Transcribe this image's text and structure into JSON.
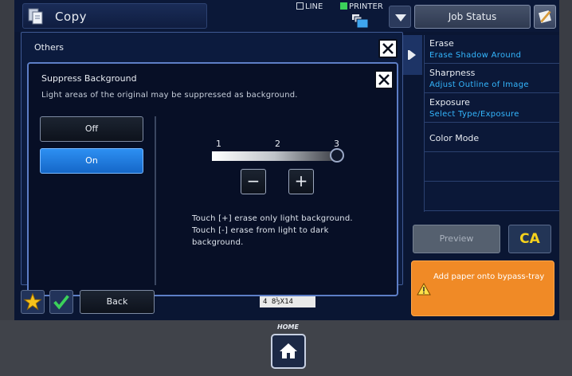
{
  "header": {
    "title": "Copy",
    "line_label": "LINE",
    "printer_label": "PRINTER",
    "job_status_label": "Job Status"
  },
  "others_dialog": {
    "title": "Others"
  },
  "suppress_dialog": {
    "title": "Suppress Background",
    "description": "Light areas of the original may be suppressed as background.",
    "options": [
      "Off",
      "On"
    ],
    "selected_option": "On",
    "levels": [
      "1",
      "2",
      "3"
    ],
    "selected_level": 3,
    "minus_label": "−",
    "plus_label": "+",
    "instructions": [
      "Touch [+] erase only light background.",
      "Touch [-] erase from light to dark",
      "background."
    ]
  },
  "functions": [
    {
      "name": "Erase",
      "value": "Erase Shadow Around"
    },
    {
      "name": "Sharpness",
      "value": "Adjust Outline of Image"
    },
    {
      "name": "Exposure",
      "value": "Select Type/Exposure"
    },
    {
      "name": "Color Mode",
      "value": ""
    }
  ],
  "buttons": {
    "preview": "Preview",
    "ca": "CA",
    "back": "Back"
  },
  "warning": {
    "text": "Add paper onto bypass-tray"
  },
  "paper_size": "4 8½X14",
  "home_label": "HOME",
  "colors": {
    "accent_blue": "#2d8ff2",
    "link_blue": "#34b7ff",
    "warning_orange": "#f08a26",
    "ca_yellow": "#f6d21c",
    "screen_bg": "#0a1633"
  }
}
